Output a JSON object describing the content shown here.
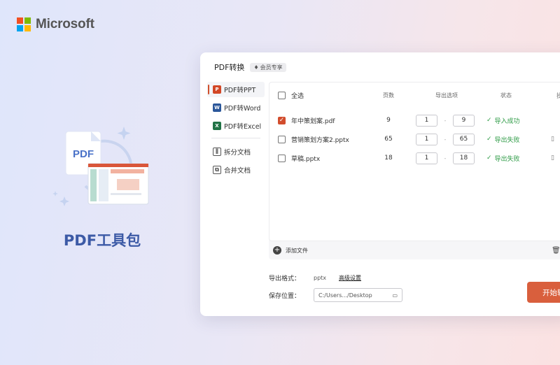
{
  "brand": {
    "name": "Microsoft",
    "logo_colors": [
      "#f25022",
      "#7fba00",
      "#00a4ef",
      "#ffb900"
    ]
  },
  "hero": {
    "title": "PDF工具包",
    "pdf_badge": "PDF"
  },
  "app": {
    "title": "PDF转换",
    "member_badge": "会员专享",
    "sidebar": {
      "items": [
        {
          "label": "PDF转PPT",
          "icon": "powerpoint-icon",
          "color": "#d24726",
          "active": true
        },
        {
          "label": "PDF转Word",
          "icon": "word-icon",
          "color": "#2b579a",
          "active": false
        },
        {
          "label": "PDF转Excel",
          "icon": "excel-icon",
          "color": "#217346",
          "active": false
        },
        {
          "label": "拆分文档",
          "icon": "split-icon",
          "active": false
        },
        {
          "label": "合并文档",
          "icon": "merge-icon",
          "active": false
        }
      ]
    },
    "table": {
      "headers": {
        "select_all": "全选",
        "pages": "页数",
        "options": "导出选项",
        "status": "状态",
        "actions": "操"
      },
      "rows": [
        {
          "checked": true,
          "name": "年中策划案.pdf",
          "pages": "9",
          "from": "1",
          "to": "9",
          "status": "导入成功"
        },
        {
          "checked": false,
          "name": "营销策划方案2.pptx",
          "pages": "65",
          "from": "1",
          "to": "65",
          "status": "导出失败"
        },
        {
          "checked": false,
          "name": "草稿.pptx",
          "pages": "18",
          "from": "1",
          "to": "18",
          "status": "导出失败"
        }
      ],
      "range_separator": "-",
      "add_file_label": "添加文件"
    },
    "settings": {
      "format_label": "导出格式：",
      "format_value": "pptx",
      "advanced_label": "高级设置",
      "save_label": "保存位置：",
      "save_path": "C:/Users.../Desktop"
    },
    "start_button": "开始转换",
    "accent": "#d95f3d",
    "success_color": "#2e9b46"
  }
}
